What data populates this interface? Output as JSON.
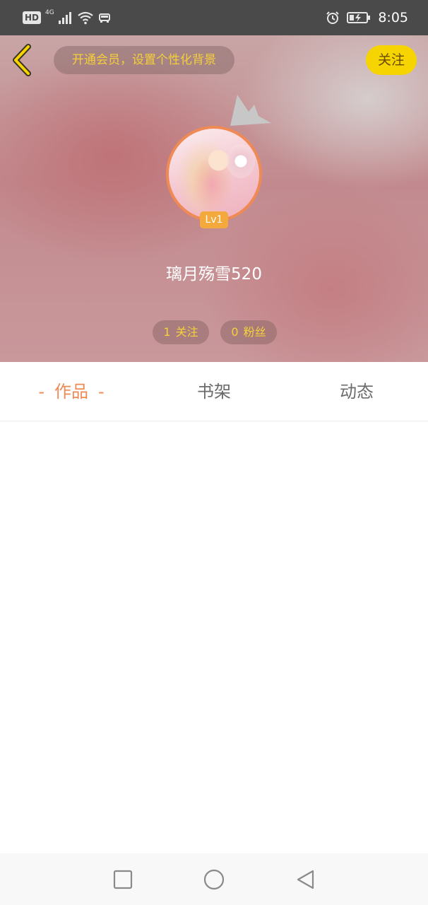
{
  "status_bar": {
    "left_badge": "HD",
    "network": "4G",
    "time": "8:05",
    "icons": [
      "signal-icon",
      "wifi-icon",
      "car-icon",
      "alarm-icon",
      "battery-icon"
    ]
  },
  "header": {
    "back_icon": "chevron-left-icon",
    "vip_banner": "开通会员，设置个性化背景",
    "follow_button": "关注"
  },
  "profile": {
    "username": "璃月殇雪520",
    "level": "Lv1",
    "crown_icon": "crown-icon",
    "following": {
      "count": "1",
      "label": "关注"
    },
    "fans": {
      "count": "0",
      "label": "粉丝"
    }
  },
  "tabs": [
    {
      "label": "作品",
      "active": true,
      "dash": "-"
    },
    {
      "label": "书架",
      "active": false
    },
    {
      "label": "动态",
      "active": false
    }
  ],
  "nav_bar": {
    "icons": [
      "recent-apps-icon",
      "home-icon",
      "back-icon"
    ]
  },
  "colors": {
    "accent": "#f08a55",
    "follow_button": "#f6d400",
    "level_badge": "#f4a93c",
    "stat_text": "#f5d23b",
    "status_bar": "#4a4a4a"
  }
}
